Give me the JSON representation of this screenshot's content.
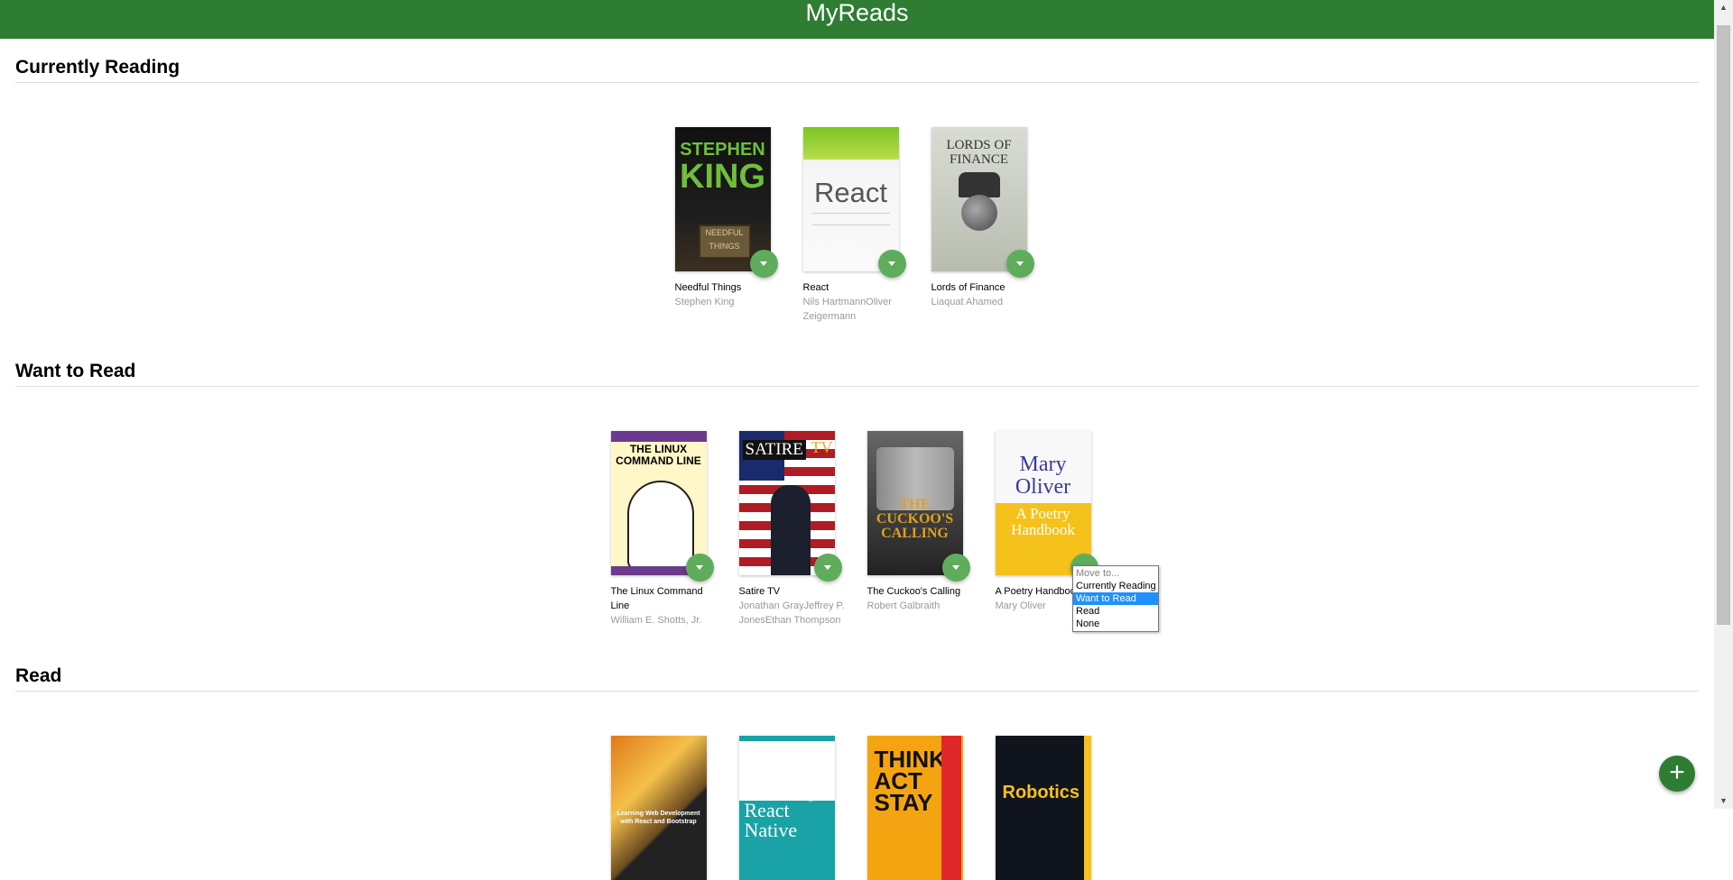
{
  "header": {
    "title": "MyReads"
  },
  "shelves": {
    "current": {
      "title": "Currently Reading",
      "books": [
        {
          "title": "Needful Things",
          "authors": "Stephen King",
          "cover_text_1": "STEPHEN",
          "cover_text_2": "KING",
          "cover_text_3": "NEEDFUL THINGS"
        },
        {
          "title": "React",
          "authors": "Nils HartmannOliver Zeigermann",
          "cover_text_1": "React"
        },
        {
          "title": "Lords of Finance",
          "authors": "Liaquat Ahamed",
          "cover_text_1": "LORDS OF FINANCE"
        }
      ]
    },
    "want": {
      "title": "Want to Read",
      "books": [
        {
          "title": "The Linux Command Line",
          "authors": "William E. Shotts, Jr.",
          "cover_text_1": "THE LINUX COMMAND LINE"
        },
        {
          "title": "Satire TV",
          "authors": "Jonathan GrayJeffrey P. JonesEthan Thompson",
          "cover_text_1": "SATIRE",
          "cover_text_2": "TV"
        },
        {
          "title": "The Cuckoo's Calling",
          "authors": "Robert Galbraith",
          "cover_text_1": "THE CUCKOO'S CALLING"
        },
        {
          "title": "A Poetry Handbook",
          "authors": "Mary Oliver",
          "cover_text_1": "Mary Oliver",
          "cover_text_2": "A Poetry Handbook"
        }
      ]
    },
    "read": {
      "title": "Read",
      "books": [
        {
          "cover_text_1": "Learning Web Development with React and Bootstrap"
        },
        {
          "cover_text_1": "Learning React Native"
        },
        {
          "cover_text_1": "THINK ACT STAY"
        },
        {
          "cover_text_1": "Robotics"
        }
      ]
    }
  },
  "move_menu": {
    "options": [
      "Move to...",
      "Currently Reading",
      "Want to Read",
      "Read",
      "None"
    ],
    "selected": "Want to Read"
  },
  "fab": {
    "label": "+"
  },
  "colors": {
    "header": "#2e7d32",
    "changer": "#60ac5d",
    "selected": "#1e90ff"
  }
}
